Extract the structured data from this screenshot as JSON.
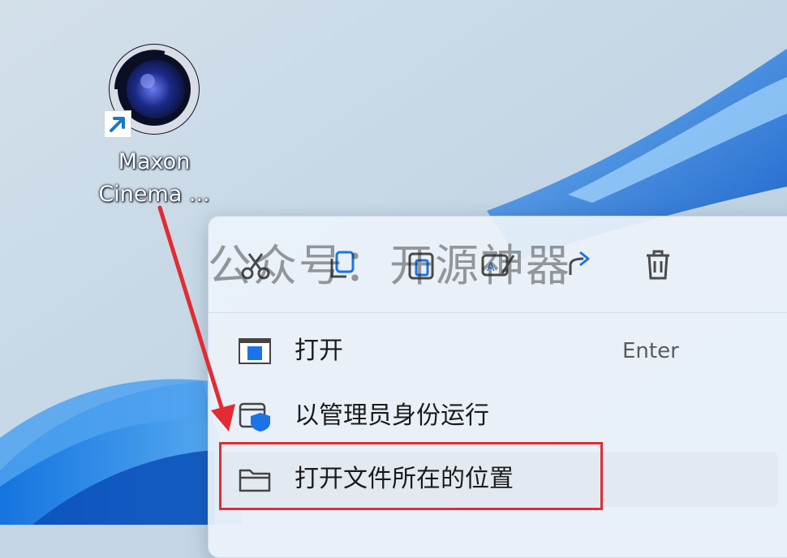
{
  "desktop": {
    "icon_label_line1": "Maxon",
    "icon_label_line2": "Cinema ..."
  },
  "context_menu": {
    "toolbar": [
      {
        "name": "cut-icon"
      },
      {
        "name": "copy-icon"
      },
      {
        "name": "paste-icon"
      },
      {
        "name": "rename-icon"
      },
      {
        "name": "share-icon"
      },
      {
        "name": "delete-icon"
      }
    ],
    "items": [
      {
        "label": "打开",
        "shortcut": "Enter",
        "icon": "open-window-icon"
      },
      {
        "label": "以管理员身份运行",
        "shortcut": "",
        "icon": "admin-shield-icon"
      },
      {
        "label": "打开文件所在的位置",
        "shortcut": "",
        "icon": "folder-icon"
      }
    ]
  },
  "watermark": "公众号：开源神器",
  "colors": {
    "accent_red": "#e22b32",
    "menu_bg": "#ecf2fa",
    "wallpaper_blue": "#1e6fd9"
  }
}
